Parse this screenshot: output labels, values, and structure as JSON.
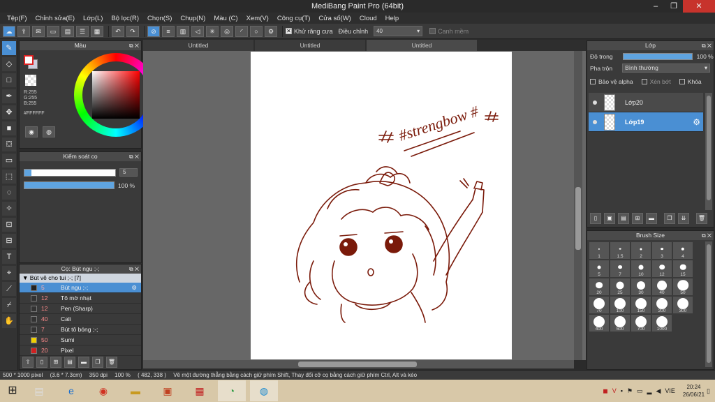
{
  "window": {
    "title": "MediBang Paint Pro (64bit)",
    "minimize": "–",
    "maximize": "❐",
    "close": "✕"
  },
  "menu": [
    "Tệp(F)",
    "Chỉnh sửa(E)",
    "Lớp(L)",
    "Bộ lọc(R)",
    "Chọn(S)",
    "Chụp(N)",
    "Màu (C)",
    "Xem(V)",
    "Công cụ(T)",
    "Cửa sổ(W)",
    "Cloud",
    "Help"
  ],
  "toolbar": {
    "antialias_label": "Khử răng cưa",
    "adjust_label": "Điều chỉnh",
    "adjust_value": "40",
    "edge_label": "Canh mềm"
  },
  "color_panel": {
    "title": "Màu",
    "r": "R:255",
    "g": "G:255",
    "b": "B:255",
    "hex": "#FFFFFF"
  },
  "brush_control": {
    "title": "Kiểm soát cọ",
    "size_value": "5",
    "opacity_value": "100 %",
    "size_fraction": 0.05,
    "opacity_fraction": 1.0
  },
  "brush_panel": {
    "title": "Cọ: Bút ngu ;-;",
    "group": "Bút vẽ cho tui ;-; [7]",
    "brushes": [
      {
        "size": "5",
        "name": "Bút ngu ;-;",
        "color": "#222222",
        "selected": true
      },
      {
        "size": "12",
        "name": "Tô mờ nhạt",
        "color": "#333333",
        "selected": false
      },
      {
        "size": "12",
        "name": "Pen (Sharp)",
        "color": "#333333",
        "selected": false
      },
      {
        "size": "40",
        "name": "Cali",
        "color": "#333333",
        "selected": false
      },
      {
        "size": "7",
        "name": "Bút tô bóng ;-;",
        "color": "#333333",
        "selected": false
      },
      {
        "size": "50",
        "name": "Sumi",
        "color": "#f0d000",
        "selected": false
      },
      {
        "size": "20",
        "name": "Pixel",
        "color": "#d02020",
        "selected": false
      }
    ]
  },
  "doc_tabs": [
    "Untitled",
    "Untitled",
    "Untitled"
  ],
  "canvas": {
    "text": "#strengbow #"
  },
  "layer_panel": {
    "title": "Lớp",
    "opacity_label": "Độ trong",
    "opacity_value": "100 %",
    "opacity_fraction": 1.0,
    "blend_label": "Pha trộn",
    "blend_value": "Bình thường",
    "protect_alpha": "Bảo vệ alpha",
    "clip": "Xén bớt",
    "lock": "Khóa",
    "layers": [
      {
        "name": "Lớp20",
        "selected": false
      },
      {
        "name": "Lớp19",
        "selected": true
      }
    ]
  },
  "brush_size_panel": {
    "title": "Brush Size",
    "sizes": [
      "1",
      "1.5",
      "2",
      "3",
      "4",
      "5",
      "7",
      "10",
      "12",
      "15",
      "20",
      "25",
      "30",
      "40",
      "50",
      "70",
      "100",
      "150",
      "200",
      "300",
      "400",
      "500",
      "700",
      "1000"
    ]
  },
  "status": {
    "dims": "500 * 1000 pixel",
    "cm": "(3.6 * 7.3cm)",
    "dpi": "350 dpi",
    "zoom": "100 %",
    "coords": "( 482, 338 )",
    "hint": "Vẽ một đường thẳng bằng cách giữ phím Shift, Thay đổi cỡ cọ bằng cách giữ phím Ctrl, Alt và kéo"
  },
  "taskbar": {
    "lang": "VIE",
    "time": "20:24",
    "date": "26/06/21"
  },
  "colors": {
    "accent": "#4a8fd3",
    "stroke": "#7a1a0a",
    "panel": "#3a3a3a"
  }
}
